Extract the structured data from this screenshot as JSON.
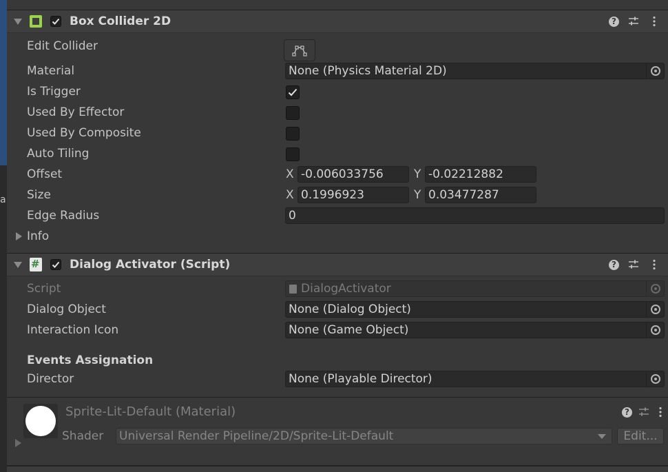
{
  "box_collider": {
    "title": "Box Collider 2D",
    "enabled": true,
    "icon_color": "#9bd34a",
    "properties": {
      "edit_collider": "Edit Collider",
      "material": "Material",
      "is_trigger": "Is Trigger",
      "used_by_effector": "Used By Effector",
      "used_by_composite": "Used By Composite",
      "auto_tiling": "Auto Tiling",
      "offset": "Offset",
      "size": "Size",
      "edge_radius": "Edge Radius",
      "info": "Info"
    },
    "values": {
      "material": "None (Physics Material 2D)",
      "is_trigger": true,
      "used_by_effector": false,
      "used_by_composite": false,
      "auto_tiling": false,
      "offset_x": "-0.006033756",
      "offset_y": "-0.02212882",
      "size_x": "0.1996923",
      "size_y": "0.03477287",
      "edge_radius": "0"
    }
  },
  "axis": {
    "x": "X",
    "y": "Y"
  },
  "dialog_activator": {
    "title": "Dialog Activator (Script)",
    "enabled": true,
    "properties": {
      "script": "Script",
      "dialog_object": "Dialog Object",
      "interaction_icon": "Interaction Icon",
      "events_header": "Events Assignation",
      "director": "Director"
    },
    "values": {
      "script": "DialogActivator",
      "dialog_object": "None (Dialog Object)",
      "interaction_icon": "None (Game Object)",
      "director": "None (Playable Director)"
    }
  },
  "material": {
    "title": "Sprite-Lit-Default (Material)",
    "shader_label": "Shader",
    "shader_value": "Universal Render Pipeline/2D/Sprite-Lit-Default",
    "edit_label": "Edit..."
  },
  "icons": {
    "help": "?",
    "hash": "#",
    "left_panel_letter": "a"
  }
}
